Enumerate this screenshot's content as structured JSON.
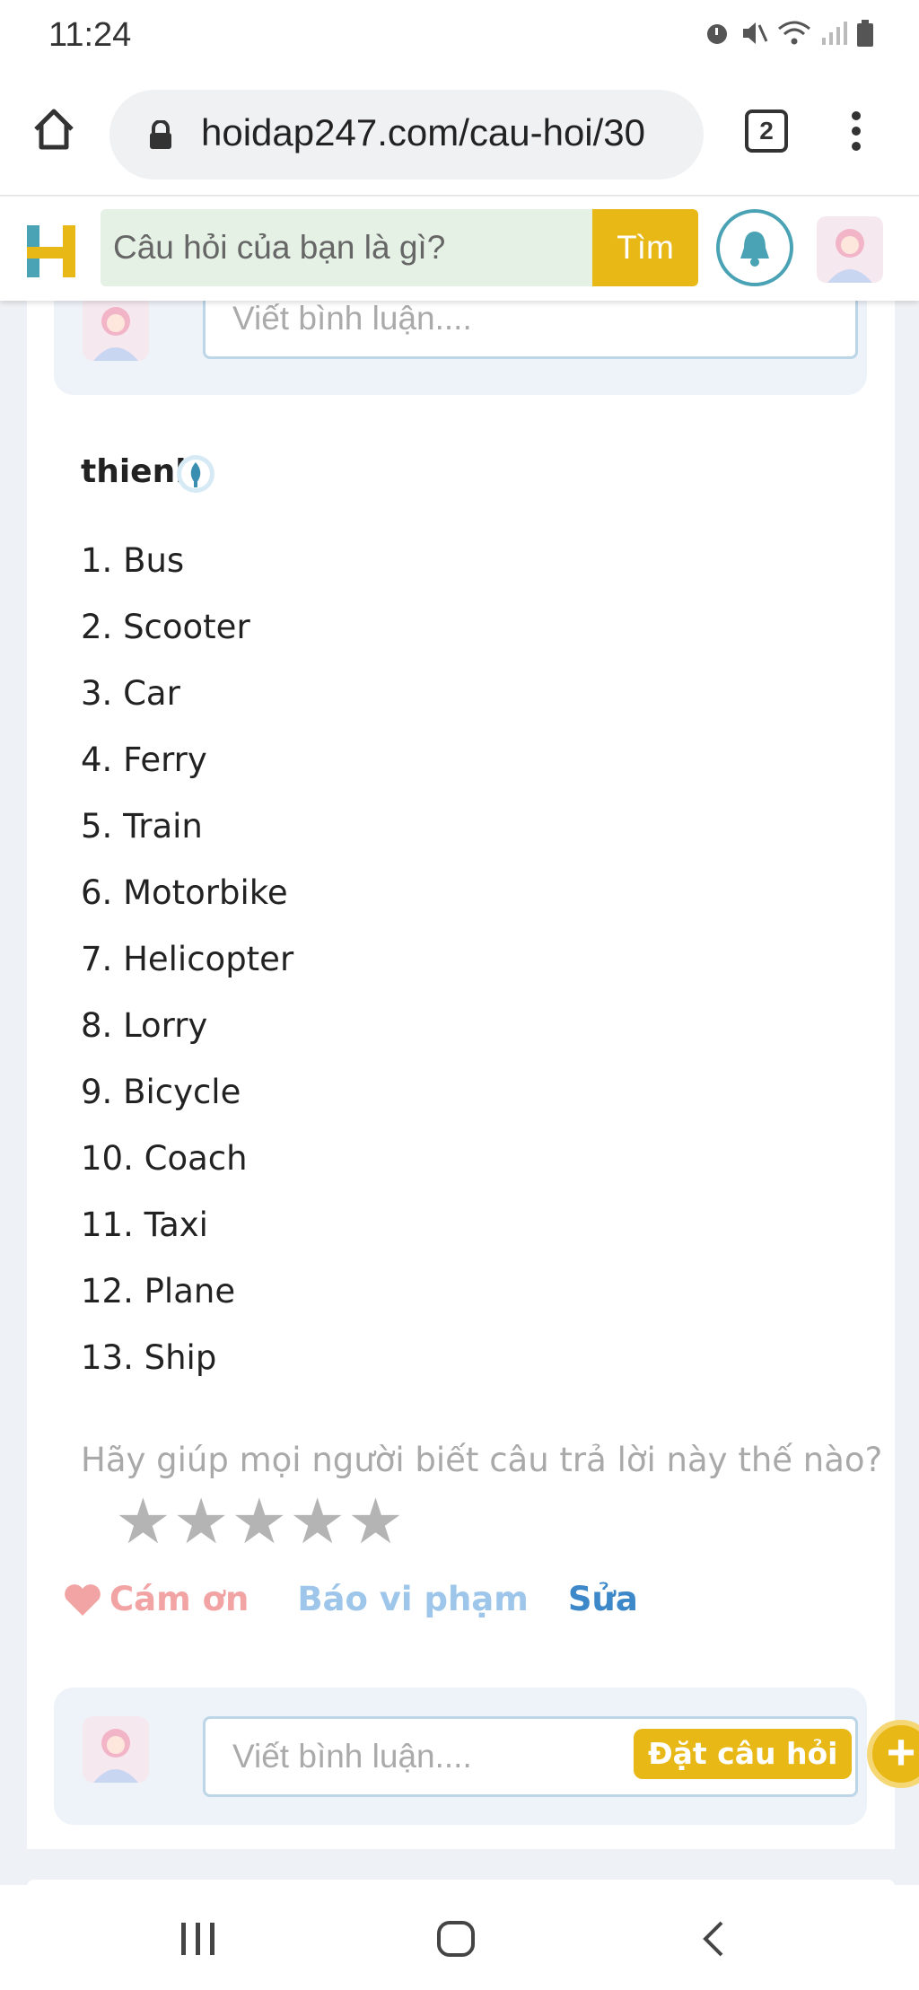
{
  "status": {
    "time": "11:24"
  },
  "browser": {
    "url": "hoidap247.com/cau-hoi/30",
    "tab_count": "2"
  },
  "header": {
    "search_placeholder": "Câu hỏi của bạn là gì?",
    "search_button": "Tìm"
  },
  "comment": {
    "placeholder": "Viết bình luận...."
  },
  "answer": {
    "username": "thienli",
    "items": [
      "1. Bus",
      "2. Scooter",
      "3. Car",
      "4. Ferry",
      "5. Train",
      "6. Motorbike",
      "7. Helicopter",
      "8. Lorry",
      "9. Bicycle",
      "10. Coach",
      "11. Taxi",
      "12. Plane",
      "13. Ship"
    ]
  },
  "rating": {
    "prompt": "Hãy giúp mọi người biết câu trả lời này thế nào?",
    "stars": 5,
    "selected": 0
  },
  "actions": {
    "thanks": "Cám ơn",
    "report": "Báo vi phạm",
    "edit": "Sửa"
  },
  "fab": {
    "ask_label": "Đặt câu hỏi",
    "plus": "+"
  },
  "colors": {
    "accent": "#e8b817",
    "teal": "#4aa3b5",
    "link_blue": "#3d88c9",
    "heart": "#f2a3a3"
  }
}
